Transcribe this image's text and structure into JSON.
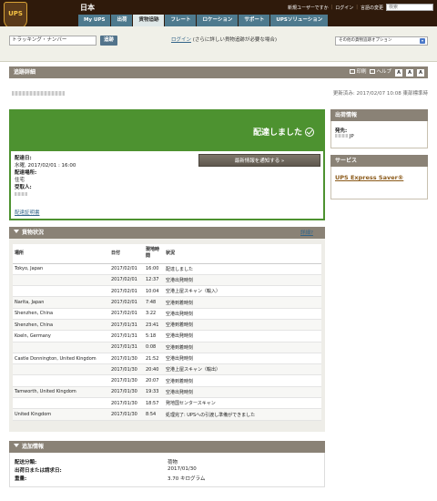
{
  "header": {
    "logo_text": "UPS",
    "country": "日本",
    "util_links": [
      "新規ユーザーですか",
      "ログイン",
      "言語の変更"
    ],
    "search_placeholder": "検索",
    "nav_tabs": [
      {
        "label": "My UPS",
        "active": false
      },
      {
        "label": "出荷",
        "active": false
      },
      {
        "label": "貨物追跡",
        "active": true
      },
      {
        "label": "フレート",
        "active": false
      },
      {
        "label": "ロケーション",
        "active": false
      },
      {
        "label": "サポート",
        "active": false
      },
      {
        "label": "UPSソリューション",
        "active": false
      }
    ]
  },
  "search": {
    "tracking_input_value": "トラッキング・ナンバー",
    "track_button": "追跡",
    "login_link": "ログイン",
    "login_note": "(さらに詳しい貨物追跡が必要な場合)",
    "options_select": "その他の貨物追跡オプション"
  },
  "tracking_detail": {
    "title": "追跡詳細",
    "print": "印刷",
    "help": "ヘルプ",
    "text_sizes": [
      "A",
      "A",
      "A"
    ],
    "updated": "更新済み: 2017/02/07 10:08 東部標準時"
  },
  "delivered": {
    "status": "配達しました",
    "date_label": "配達日:",
    "date_value": "水曜, 2017/02/01 : 16:00",
    "location_label": "配達場所:",
    "location_value": "住宅",
    "receiver_label": "受取人:",
    "notify_button": "最新情報を通知する »",
    "proof_link": "配達証明書"
  },
  "shipping_info": {
    "title": "出荷情報",
    "from_label": "発先:",
    "from_value": "JP"
  },
  "services": {
    "title": "サービス",
    "link": "UPS Express Saver®"
  },
  "package_progress": {
    "title": "貨物状況",
    "detail_link": "詳細?",
    "headers": [
      "場所",
      "日付",
      "現地時間",
      "状況"
    ],
    "rows": [
      [
        "Tokyo, Japan",
        "2017/02/01",
        "16:00",
        "配達しました"
      ],
      [
        "",
        "2017/02/01",
        "12:37",
        "空港出発時刻"
      ],
      [
        "",
        "2017/02/01",
        "10:04",
        "空港上屋スキャン（輸入）"
      ],
      [
        "Narita, Japan",
        "2017/02/01",
        "7:48",
        "空港到着時刻"
      ],
      [
        "Shenzhen, China",
        "2017/02/01",
        "3:22",
        "空港出発時刻"
      ],
      [
        "Shenzhen, China",
        "2017/01/31",
        "23:41",
        "空港到着時刻"
      ],
      [
        "Koeln, Germany",
        "2017/01/31",
        "5:18",
        "空港出発時刻"
      ],
      [
        "",
        "2017/01/31",
        "0:08",
        "空港到着時刻"
      ],
      [
        "Castle Donnington, United Kingdom",
        "2017/01/30",
        "21:52",
        "空港出発時刻"
      ],
      [
        "",
        "2017/01/30",
        "20:40",
        "空港上屋スキャン（輸出）"
      ],
      [
        "",
        "2017/01/30",
        "20:07",
        "空港到着時刻"
      ],
      [
        "Tamworth, United Kingdom",
        "2017/01/30",
        "19:33",
        "空港出発時刻"
      ],
      [
        "",
        "2017/01/30",
        "18:57",
        "発地国センタースキャン"
      ],
      [
        "United Kingdom",
        "2017/01/30",
        "8:54",
        "処理完了: UPSへの引渡し準備ができました"
      ]
    ]
  },
  "additional_info": {
    "title": "追加情報",
    "rows": [
      {
        "label": "配送分類:",
        "value": "荷物"
      },
      {
        "label": "出荷日または請求日:",
        "value": "2017/01/30"
      },
      {
        "label": "重量:",
        "value": "3.70 キログラム"
      }
    ]
  }
}
